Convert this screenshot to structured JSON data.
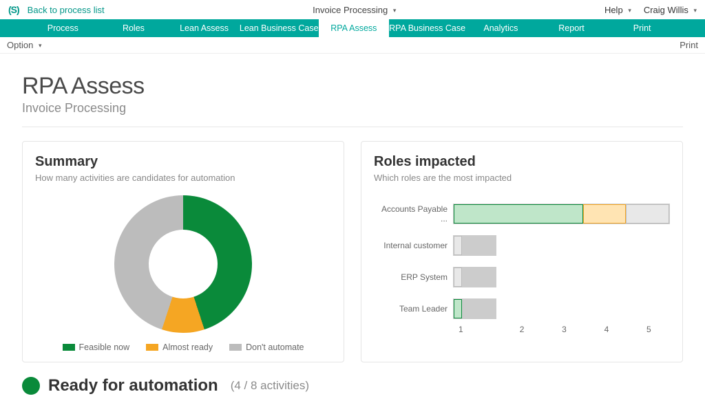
{
  "top": {
    "back_label": "Back to process list",
    "process_dd": "Invoice Processing",
    "help_label": "Help",
    "user_name": "Craig Willis"
  },
  "tabs": [
    "Process",
    "Roles",
    "Lean Assess",
    "Lean Business Case",
    "RPA Assess",
    "RPA Business Case",
    "Analytics",
    "Report",
    "Print"
  ],
  "active_tab_index": 4,
  "subbar": {
    "option_label": "Option",
    "print_label": "Print"
  },
  "page": {
    "title": "RPA Assess",
    "subtitle": "Invoice Processing"
  },
  "summary_card": {
    "title": "Summary",
    "subtitle": "How many activities are candidates for automation",
    "legend": {
      "feasible": "Feasible now",
      "almost": "Almost ready",
      "dont": "Don't automate"
    }
  },
  "roles_card": {
    "title": "Roles impacted",
    "subtitle": "Which roles are the most impacted",
    "roles": [
      {
        "label": "Accounts Payable ...",
        "green": 3,
        "orange": 1,
        "grey": 1
      },
      {
        "label": "Internal customer",
        "green": 0,
        "orange": 0,
        "grey": 1
      },
      {
        "label": "ERP System",
        "green": 0,
        "orange": 0,
        "grey": 1
      },
      {
        "label": "Team Leader",
        "green": 1,
        "orange": 0,
        "grey": 0
      }
    ],
    "axis": [
      "1",
      "2",
      "3",
      "4",
      "5"
    ],
    "max": 5
  },
  "ready": {
    "label": "Ready for automation",
    "count_text": "(4 / 8 activities)"
  },
  "chart_data": [
    {
      "type": "pie",
      "title": "Summary — candidates for automation",
      "series": [
        {
          "name": "Feasible now",
          "value": 4,
          "color": "#0a8a3a"
        },
        {
          "name": "Almost ready",
          "value": 1,
          "color": "#f5a623"
        },
        {
          "name": "Don't automate",
          "value": 3,
          "color": "#bcbcbc"
        }
      ]
    },
    {
      "type": "bar",
      "title": "Roles impacted",
      "xlabel": "",
      "ylabel": "",
      "xlim": [
        0,
        5
      ],
      "categories": [
        "Accounts Payable ...",
        "Internal customer",
        "ERP System",
        "Team Leader"
      ],
      "series": [
        {
          "name": "Feasible now",
          "values": [
            3,
            0,
            0,
            1
          ],
          "color": "#0a8a3a"
        },
        {
          "name": "Almost ready",
          "values": [
            1,
            0,
            0,
            0
          ],
          "color": "#f5a623"
        },
        {
          "name": "Don't automate",
          "values": [
            1,
            1,
            1,
            0
          ],
          "color": "#bcbcbc"
        }
      ]
    }
  ]
}
